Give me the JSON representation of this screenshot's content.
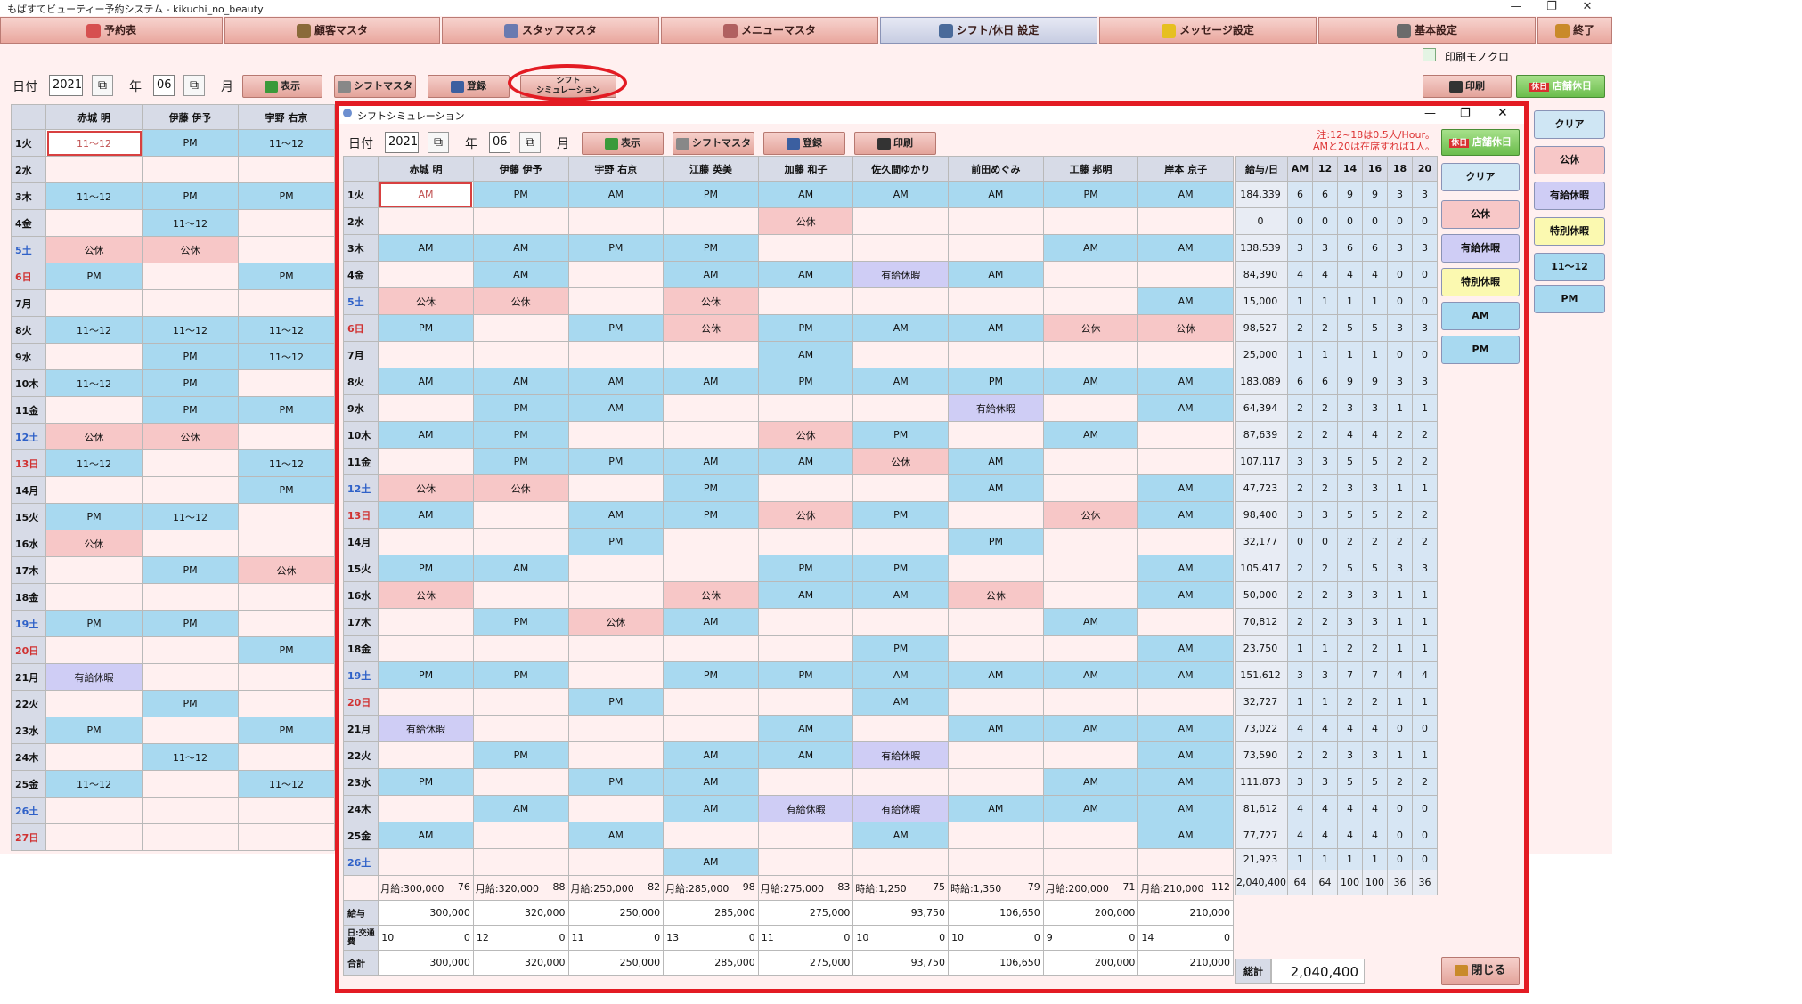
{
  "app": {
    "title": "もばすてビューティー予約システム - kikuchi_no_beauty",
    "win_min": "—",
    "win_max": "❐",
    "win_close": "✕"
  },
  "tabs": [
    {
      "label": "予約表",
      "icon": "calendar-icon",
      "active": false
    },
    {
      "label": "顧客マスタ",
      "icon": "customers-icon",
      "active": false
    },
    {
      "label": "スタッフマスタ",
      "icon": "staff-icon",
      "active": false
    },
    {
      "label": "メニューマスタ",
      "icon": "menu-icon",
      "active": false
    },
    {
      "label": "シフト/休日 設定",
      "icon": "shift-icon",
      "active": true
    },
    {
      "label": "メッセージ設定",
      "icon": "message-icon",
      "active": false
    },
    {
      "label": "基本設定",
      "icon": "tools-icon",
      "active": false
    },
    {
      "label": "終了",
      "icon": "exit-icon",
      "active": false
    }
  ],
  "colors": {
    "accent_red": "#e31b23",
    "tab_pink": "#e9a79e",
    "cell_blue": "#a8d9f0",
    "cell_pink": "#f7c7c7",
    "cell_purple": "#cfcdf5"
  },
  "main": {
    "date_label": "日付",
    "year": "2021",
    "year_unit": "年",
    "month": "06",
    "month_unit": "月",
    "buttons": {
      "show": "表示",
      "shift_master": "シフトマスタ",
      "register": "登録",
      "simulation": "シフト\nシミュレーション",
      "print": "印刷",
      "store_holiday": "店舗休日",
      "store_badge": "休日",
      "clear": "クリア",
      "public_off": "公休",
      "paid_leave": "有給休暇",
      "special_leave": "特別休暇",
      "h11": "11～12",
      "pm": "PM"
    },
    "print_mono_label": "印刷モノクロ",
    "staff": [
      "赤城 明",
      "伊藤 伊予",
      "宇野 右京"
    ],
    "rows": [
      {
        "d": "1火",
        "t": "",
        "c": [
          "11～12",
          "PM",
          "11～12"
        ]
      },
      {
        "d": "2水",
        "t": "",
        "c": [
          "",
          "",
          ""
        ]
      },
      {
        "d": "3木",
        "t": "",
        "c": [
          "11～12",
          "PM",
          "PM"
        ]
      },
      {
        "d": "4金",
        "t": "",
        "c": [
          "",
          "11～12",
          ""
        ]
      },
      {
        "d": "5土",
        "t": "sat",
        "c": [
          "公休",
          "公休",
          ""
        ]
      },
      {
        "d": "6日",
        "t": "sun",
        "c": [
          "PM",
          "",
          "PM"
        ]
      },
      {
        "d": "7月",
        "t": "",
        "c": [
          "",
          "",
          ""
        ]
      },
      {
        "d": "8火",
        "t": "",
        "c": [
          "11～12",
          "11～12",
          "11～12"
        ]
      },
      {
        "d": "9水",
        "t": "",
        "c": [
          "",
          "PM",
          "11～12"
        ]
      },
      {
        "d": "10木",
        "t": "",
        "c": [
          "11～12",
          "PM",
          ""
        ]
      },
      {
        "d": "11金",
        "t": "",
        "c": [
          "",
          "PM",
          "PM"
        ]
      },
      {
        "d": "12土",
        "t": "sat",
        "c": [
          "公休",
          "公休",
          ""
        ]
      },
      {
        "d": "13日",
        "t": "sun",
        "c": [
          "11～12",
          "",
          "11～12"
        ]
      },
      {
        "d": "14月",
        "t": "",
        "c": [
          "",
          "",
          "PM"
        ]
      },
      {
        "d": "15火",
        "t": "",
        "c": [
          "PM",
          "11～12",
          ""
        ]
      },
      {
        "d": "16水",
        "t": "",
        "c": [
          "公休",
          "",
          ""
        ]
      },
      {
        "d": "17木",
        "t": "",
        "c": [
          "",
          "PM",
          "公休"
        ]
      },
      {
        "d": "18金",
        "t": "",
        "c": [
          "",
          "",
          ""
        ]
      },
      {
        "d": "19土",
        "t": "sat",
        "c": [
          "PM",
          "PM",
          ""
        ]
      },
      {
        "d": "20日",
        "t": "sun",
        "c": [
          "",
          "",
          "PM"
        ]
      },
      {
        "d": "21月",
        "t": "",
        "c": [
          "有給休暇",
          "",
          ""
        ]
      },
      {
        "d": "22火",
        "t": "",
        "c": [
          "",
          "PM",
          ""
        ]
      },
      {
        "d": "23水",
        "t": "",
        "c": [
          "PM",
          "",
          "PM"
        ]
      },
      {
        "d": "24木",
        "t": "",
        "c": [
          "",
          "11～12",
          ""
        ]
      },
      {
        "d": "25金",
        "t": "",
        "c": [
          "11～12",
          "",
          "11～12"
        ]
      },
      {
        "d": "26土",
        "t": "sat",
        "c": [
          "",
          "",
          ""
        ]
      },
      {
        "d": "27日",
        "t": "sun",
        "c": [
          "",
          "",
          ""
        ]
      }
    ]
  },
  "sim": {
    "title": "シフトシミュレーション",
    "date_label": "日付",
    "year": "2021",
    "year_unit": "年",
    "month": "06",
    "month_unit": "月",
    "buttons": {
      "show": "表示",
      "shift_master": "シフトマスタ",
      "register": "登録",
      "print": "印刷",
      "store_holiday": "店舗休日",
      "store_badge": "休日",
      "clear": "クリア",
      "public_off": "公休",
      "paid_leave": "有給休暇",
      "special_leave": "特別休暇",
      "am": "AM",
      "pm": "PM",
      "close": "閉じる"
    },
    "note1": "注:12~18は0.5人/Hour。",
    "note2": "AMと20は在席すれば1人。",
    "staff": [
      "赤城 明",
      "伊藤 伊予",
      "宇野 右京",
      "江藤 英美",
      "加藤 和子",
      "佐久間ゆかり",
      "前田めぐみ",
      "工藤 邦明",
      "岸本 京子"
    ],
    "stat_headers": [
      "給与/日",
      "AM",
      "12",
      "14",
      "16",
      "18",
      "20"
    ],
    "rows": [
      {
        "d": "1火",
        "t": "",
        "c": [
          "AM",
          "PM",
          "AM",
          "PM",
          "AM",
          "AM",
          "AM",
          "PM",
          "AM"
        ],
        "s": [
          "184,339",
          "6",
          "6",
          "9",
          "9",
          "3",
          "3"
        ]
      },
      {
        "d": "2水",
        "t": "",
        "c": [
          "",
          "",
          "",
          "",
          "公休",
          "",
          "",
          "",
          ""
        ],
        "s": [
          "0",
          "0",
          "0",
          "0",
          "0",
          "0",
          "0"
        ]
      },
      {
        "d": "3木",
        "t": "",
        "c": [
          "AM",
          "AM",
          "PM",
          "PM",
          "",
          "",
          "",
          "AM",
          "AM"
        ],
        "s": [
          "138,539",
          "3",
          "3",
          "6",
          "6",
          "3",
          "3"
        ]
      },
      {
        "d": "4金",
        "t": "",
        "c": [
          "",
          "AM",
          "",
          "AM",
          "AM",
          "有給休暇",
          "AM",
          "",
          ""
        ],
        "s": [
          "84,390",
          "4",
          "4",
          "4",
          "4",
          "0",
          "0"
        ]
      },
      {
        "d": "5土",
        "t": "sat",
        "c": [
          "公休",
          "公休",
          "",
          "公休",
          "",
          "",
          "",
          "",
          "AM"
        ],
        "s": [
          "15,000",
          "1",
          "1",
          "1",
          "1",
          "0",
          "0"
        ]
      },
      {
        "d": "6日",
        "t": "sun",
        "c": [
          "PM",
          "",
          "PM",
          "公休",
          "PM",
          "AM",
          "AM",
          "公休",
          "公休"
        ],
        "s": [
          "98,527",
          "2",
          "2",
          "5",
          "5",
          "3",
          "3"
        ]
      },
      {
        "d": "7月",
        "t": "",
        "c": [
          "",
          "",
          "",
          "",
          "AM",
          "",
          "",
          "",
          ""
        ],
        "s": [
          "25,000",
          "1",
          "1",
          "1",
          "1",
          "0",
          "0"
        ]
      },
      {
        "d": "8火",
        "t": "",
        "c": [
          "AM",
          "AM",
          "AM",
          "AM",
          "PM",
          "AM",
          "PM",
          "AM",
          "AM"
        ],
        "s": [
          "183,089",
          "6",
          "6",
          "9",
          "9",
          "3",
          "3"
        ]
      },
      {
        "d": "9水",
        "t": "",
        "c": [
          "",
          "PM",
          "AM",
          "",
          "",
          "",
          "有給休暇",
          "",
          "AM"
        ],
        "s": [
          "64,394",
          "2",
          "2",
          "3",
          "3",
          "1",
          "1"
        ]
      },
      {
        "d": "10木",
        "t": "",
        "c": [
          "AM",
          "PM",
          "",
          "",
          "公休",
          "PM",
          "",
          "AM",
          ""
        ],
        "s": [
          "87,639",
          "2",
          "2",
          "4",
          "4",
          "2",
          "2"
        ]
      },
      {
        "d": "11金",
        "t": "",
        "c": [
          "",
          "PM",
          "PM",
          "AM",
          "AM",
          "公休",
          "AM",
          "",
          ""
        ],
        "s": [
          "107,117",
          "3",
          "3",
          "5",
          "5",
          "2",
          "2"
        ]
      },
      {
        "d": "12土",
        "t": "sat",
        "c": [
          "公休",
          "公休",
          "",
          "PM",
          "",
          "",
          "AM",
          "",
          "AM"
        ],
        "s": [
          "47,723",
          "2",
          "2",
          "3",
          "3",
          "1",
          "1"
        ]
      },
      {
        "d": "13日",
        "t": "sun",
        "c": [
          "AM",
          "",
          "AM",
          "PM",
          "公休",
          "PM",
          "",
          "公休",
          "AM"
        ],
        "s": [
          "98,400",
          "3",
          "3",
          "5",
          "5",
          "2",
          "2"
        ]
      },
      {
        "d": "14月",
        "t": "",
        "c": [
          "",
          "",
          "PM",
          "",
          "",
          "",
          "PM",
          "",
          ""
        ],
        "s": [
          "32,177",
          "0",
          "0",
          "2",
          "2",
          "2",
          "2"
        ]
      },
      {
        "d": "15火",
        "t": "",
        "c": [
          "PM",
          "AM",
          "",
          "",
          "PM",
          "PM",
          "",
          "",
          "AM"
        ],
        "s": [
          "105,417",
          "2",
          "2",
          "5",
          "5",
          "3",
          "3"
        ]
      },
      {
        "d": "16水",
        "t": "",
        "c": [
          "公休",
          "",
          "",
          "公休",
          "AM",
          "AM",
          "公休",
          "",
          "AM"
        ],
        "s": [
          "50,000",
          "2",
          "2",
          "3",
          "3",
          "1",
          "1"
        ]
      },
      {
        "d": "17木",
        "t": "",
        "c": [
          "",
          "PM",
          "公休",
          "AM",
          "",
          "",
          "",
          "AM",
          ""
        ],
        "s": [
          "70,812",
          "2",
          "2",
          "3",
          "3",
          "1",
          "1"
        ]
      },
      {
        "d": "18金",
        "t": "",
        "c": [
          "",
          "",
          "",
          "",
          "",
          "PM",
          "",
          "",
          "AM"
        ],
        "s": [
          "23,750",
          "1",
          "1",
          "2",
          "2",
          "1",
          "1"
        ]
      },
      {
        "d": "19土",
        "t": "sat",
        "c": [
          "PM",
          "PM",
          "",
          "PM",
          "PM",
          "AM",
          "AM",
          "AM",
          "AM"
        ],
        "s": [
          "151,612",
          "3",
          "3",
          "7",
          "7",
          "4",
          "4"
        ]
      },
      {
        "d": "20日",
        "t": "sun",
        "c": [
          "",
          "",
          "PM",
          "",
          "",
          "AM",
          "",
          "",
          ""
        ],
        "s": [
          "32,727",
          "1",
          "1",
          "2",
          "2",
          "1",
          "1"
        ]
      },
      {
        "d": "21月",
        "t": "",
        "c": [
          "有給休暇",
          "",
          "",
          "",
          "AM",
          "",
          "AM",
          "AM",
          "AM"
        ],
        "s": [
          "73,022",
          "4",
          "4",
          "4",
          "4",
          "0",
          "0"
        ]
      },
      {
        "d": "22火",
        "t": "",
        "c": [
          "",
          "PM",
          "",
          "AM",
          "AM",
          "有給休暇",
          "",
          "",
          "AM"
        ],
        "s": [
          "73,590",
          "2",
          "2",
          "3",
          "3",
          "1",
          "1"
        ]
      },
      {
        "d": "23水",
        "t": "",
        "c": [
          "PM",
          "",
          "PM",
          "AM",
          "",
          "",
          "",
          "AM",
          "AM"
        ],
        "s": [
          "111,873",
          "3",
          "3",
          "5",
          "5",
          "2",
          "2"
        ]
      },
      {
        "d": "24木",
        "t": "",
        "c": [
          "",
          "AM",
          "",
          "AM",
          "有給休暇",
          "有給休暇",
          "AM",
          "AM",
          "AM"
        ],
        "s": [
          "81,612",
          "4",
          "4",
          "4",
          "4",
          "0",
          "0"
        ]
      },
      {
        "d": "25金",
        "t": "",
        "c": [
          "AM",
          "",
          "AM",
          "",
          "",
          "AM",
          "",
          "",
          "AM"
        ],
        "s": [
          "77,727",
          "4",
          "4",
          "4",
          "4",
          "0",
          "0"
        ]
      },
      {
        "d": "26土",
        "t": "sat",
        "c": [
          "",
          "",
          "",
          "AM",
          "",
          "",
          "",
          "",
          ""
        ],
        "s": [
          "21,923",
          "1",
          "1",
          "1",
          "1",
          "0",
          "0"
        ]
      }
    ],
    "sum_row": [
      {
        "wage": "月給:300,000",
        "n": "76"
      },
      {
        "wage": "月給:320,000",
        "n": "88"
      },
      {
        "wage": "月給:250,000",
        "n": "82"
      },
      {
        "wage": "月給:285,000",
        "n": "98"
      },
      {
        "wage": "月給:275,000",
        "n": "83"
      },
      {
        "wage": "時給:1,250",
        "n": "75"
      },
      {
        "wage": "時給:1,350",
        "n": "79"
      },
      {
        "wage": "月給:200,000",
        "n": "71"
      },
      {
        "wage": "月給:210,000",
        "n": "112"
      }
    ],
    "sum_stats": [
      "2,040,400",
      "64",
      "64",
      "100",
      "100",
      "36",
      "36"
    ],
    "labels": {
      "salary": "給与",
      "days": "日:交通費",
      "total": "合計",
      "grand": "総計"
    },
    "salary": [
      "300,000",
      "320,000",
      "250,000",
      "285,000",
      "275,000",
      "93,750",
      "106,650",
      "200,000",
      "210,000"
    ],
    "days": [
      {
        "d": "10",
        "f": "0"
      },
      {
        "d": "12",
        "f": "0"
      },
      {
        "d": "11",
        "f": "0"
      },
      {
        "d": "13",
        "f": "0"
      },
      {
        "d": "11",
        "f": "0"
      },
      {
        "d": "10",
        "f": "0"
      },
      {
        "d": "10",
        "f": "0"
      },
      {
        "d": "9",
        "f": "0"
      },
      {
        "d": "14",
        "f": "0"
      }
    ],
    "total": [
      "300,000",
      "320,000",
      "250,000",
      "285,000",
      "275,000",
      "93,750",
      "106,650",
      "200,000",
      "210,000"
    ],
    "grand_total": "2,040,400"
  }
}
